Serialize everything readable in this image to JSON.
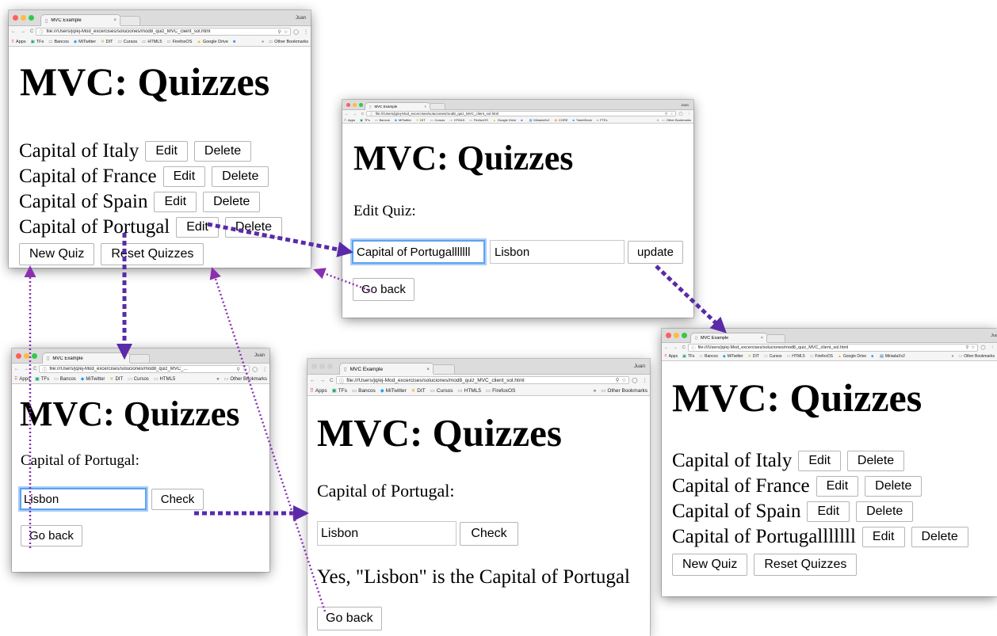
{
  "chrome": {
    "tab_title": "MVC Example",
    "close_glyph": "×",
    "profile": "Juan",
    "url": "file:///Users/jq/ej-Mod_excercises/soluciones/mod8_quiz_MVC_client_sol.html",
    "url_short": "file:///Users/jq/ej-Mod_excercises/soluciones/mod8_quiz_MVC_...",
    "bookmarks_overflow": "»",
    "other_bookmarks": "Other Bookmarks",
    "bookmarks": {
      "apps": "Apps",
      "tfs": "TFs",
      "bancos": "Bancos",
      "miTwitter": "MiTwitter",
      "dit": "DIT",
      "cursos": "Cursos",
      "html5": "HTML5",
      "firefoxos": "FirefoxOS",
      "googleDrive": "Google Drive",
      "miriadax": "MiriadaXv2",
      "core": "CORE",
      "tweetdeck": "TweetDeck",
      "ftel": "FTEL"
    },
    "icons": {
      "back": "arrow-left-icon",
      "forward": "arrow-right-icon",
      "reload": "reload-icon",
      "info": "info-icon",
      "zoom": "zoom-icon",
      "star": "star-icon",
      "menu": "kebab-menu-icon",
      "page": "page-icon",
      "folder": "folder-icon"
    },
    "colors": {
      "close": "#fc605b",
      "minimize": "#fdbc40",
      "maximize": "#34c84a"
    }
  },
  "app": {
    "heading": "MVC: Quizzes",
    "edit_label": "Edit",
    "delete_label": "Delete",
    "new_quiz_label": "New Quiz",
    "reset_label": "Reset Quizzes",
    "go_back_label": "Go back",
    "check_label": "Check",
    "update_label": "update",
    "edit_quiz_title": "Edit Quiz:"
  },
  "windows": {
    "list_initial": {
      "quizzes": [
        "Capital of Italy",
        "Capital of France",
        "Capital of Spain",
        "Capital of Portugal"
      ]
    },
    "edit": {
      "question_value": "Capital of Portugalllllll",
      "answer_value": "Lisbon"
    },
    "play_typing": {
      "question": "Capital of Portugal:",
      "answer_value": "Lisbon"
    },
    "play_result": {
      "question": "Capital of Portugal:",
      "answer_value": "Lisbon",
      "result": "Yes, \"Lisbon\" is the Capital of Portugal"
    },
    "list_updated": {
      "quizzes": [
        "Capital of Italy",
        "Capital of France",
        "Capital of Spain",
        "Capital of Portugalllllll"
      ]
    }
  },
  "arrows": {
    "thick_color": "#5a2aa8",
    "dotted_color": "#8a2fb0"
  }
}
